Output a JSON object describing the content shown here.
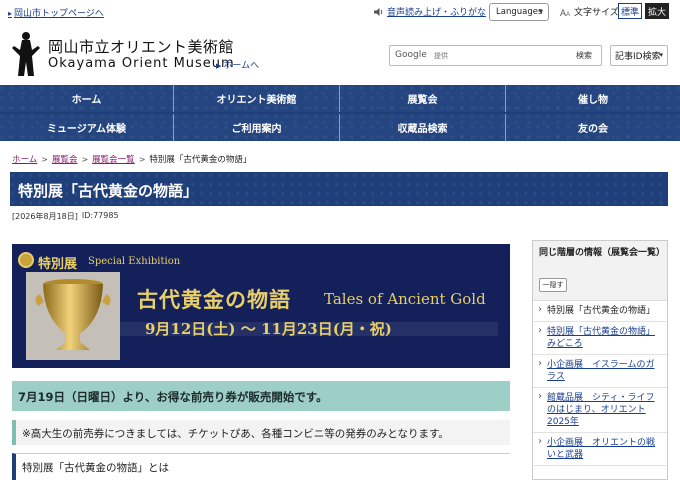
{
  "topbar": {
    "city_link": "岡山市トップページへ",
    "speech_link": "音声読み上げ・ふりがな",
    "languages": "Languages",
    "text_size_label": "文字サイズ",
    "text_size_normal": "標準",
    "text_size_large": "拡大"
  },
  "header": {
    "site_name_jp": "岡山市立オリエント美術館",
    "site_name_en": "Okayama Orient Museum",
    "home_link": "ホームへ",
    "search_brand": "Google",
    "search_placeholder": "提供",
    "search_button": "検索",
    "id_search": "記事ID検索"
  },
  "nav": {
    "items": [
      "ホーム",
      "オリエント美術館",
      "展覧会",
      "催し物",
      "ミュージアム体験",
      "ご利用案内",
      "収蔵品検索",
      "友の会"
    ]
  },
  "breadcrumb": {
    "items": [
      "ホーム",
      "展覧会",
      "展覧会一覧"
    ],
    "current": "特別展「古代黄金の物語」"
  },
  "page": {
    "title": "特別展「古代黄金の物語」",
    "date": "[2026年8月18日]",
    "id": "ID:77985"
  },
  "banner": {
    "label_jp": "特別展",
    "label_en": "Special Exhibition",
    "title_jp": "古代黄金の物語",
    "title_en": "Tales of Ancient Gold",
    "dates": "9月12日(土) ～ 11月23日(月・祝)"
  },
  "content": {
    "notice_sale": "7月19日（日曜日）より、お得な前売り券が販売開始です。",
    "notice_students": "※高大生の前売券につきましては、チケットぴあ、各種コンビニ等の発券のみとなります。",
    "section_heading": "特別展「古代黄金の物語」とは"
  },
  "sidebar": {
    "title": "同じ階層の情報（展覧会一覧）",
    "hide_button": "一隠す",
    "items": [
      {
        "label": "特別展「古代黄金の物語」",
        "link": false
      },
      {
        "label": "特別展「古代黄金の物語」みどころ",
        "link": true
      },
      {
        "label": "小企画展　イスラームのガラス",
        "link": true
      },
      {
        "label": "館蔵品展　シティ・ライフのはじまり、オリエント 2025年",
        "link": true
      },
      {
        "label": "小企画展　オリエントの戦いと武器",
        "link": true
      }
    ]
  },
  "colors": {
    "nav_blue": "#1f3f7a",
    "gold": "#e8cf68",
    "banner_navy": "#13205a",
    "notice_green": "#9dcfc6",
    "link_purple": "#8a1a6b"
  }
}
